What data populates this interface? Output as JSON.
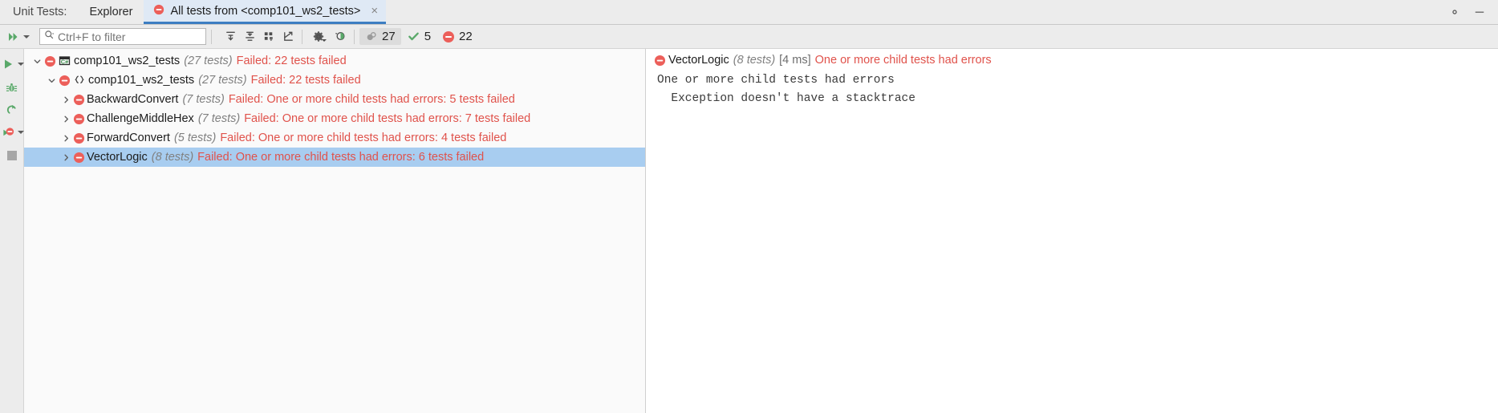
{
  "tabbar": {
    "label": "Unit Tests:",
    "explorer": "Explorer",
    "active_tab": "All tests from <comp101_ws2_tests>",
    "close_glyph": "×",
    "status_icon": "error-circle-icon"
  },
  "toolbar": {
    "search_placeholder": "Ctrl+F to filter",
    "search_value": "",
    "counters": {
      "total_label": "27",
      "passed_label": "5",
      "failed_label": "22"
    }
  },
  "colors": {
    "fail_red": "#e0524b",
    "fail_icon": "#ec5f5a",
    "pass_green": "#59a869",
    "selection_blue": "#a8cdf0",
    "tab_accent": "#3d7ec2"
  },
  "tree": [
    {
      "name": "comp101_ws2_tests",
      "count": "(27 tests)",
      "message": "Failed: 22 tests failed",
      "indent": 0,
      "expanded": true,
      "type_icon": "csharp-project-icon",
      "selected": false
    },
    {
      "name": "comp101_ws2_tests",
      "count": "(27 tests)",
      "message": "Failed: 22 tests failed",
      "indent": 1,
      "expanded": true,
      "type_icon": "namespace-icon",
      "selected": false
    },
    {
      "name": "BackwardConvert",
      "count": "(7 tests)",
      "message": "Failed: One or more child tests had errors: 5 tests failed",
      "indent": 2,
      "expanded": false,
      "type_icon": "none",
      "selected": false
    },
    {
      "name": "ChallengeMiddleHex",
      "count": "(7 tests)",
      "message": "Failed: One or more child tests had errors: 7 tests failed",
      "indent": 2,
      "expanded": false,
      "type_icon": "none",
      "selected": false
    },
    {
      "name": "ForwardConvert",
      "count": "(5 tests)",
      "message": "Failed: One or more child tests had errors: 4 tests failed",
      "indent": 2,
      "expanded": false,
      "type_icon": "none",
      "selected": false
    },
    {
      "name": "VectorLogic",
      "count": "(8 tests)",
      "message": "Failed: One or more child tests had errors: 6 tests failed",
      "indent": 2,
      "expanded": false,
      "type_icon": "none",
      "selected": true
    }
  ],
  "detail": {
    "name": "VectorLogic",
    "count": "(8 tests)",
    "duration": "[4 ms]",
    "message": "One or more child tests had errors",
    "body_line_1": "One or more child tests had errors",
    "body_line_2": "  Exception doesn't have a stacktrace"
  }
}
